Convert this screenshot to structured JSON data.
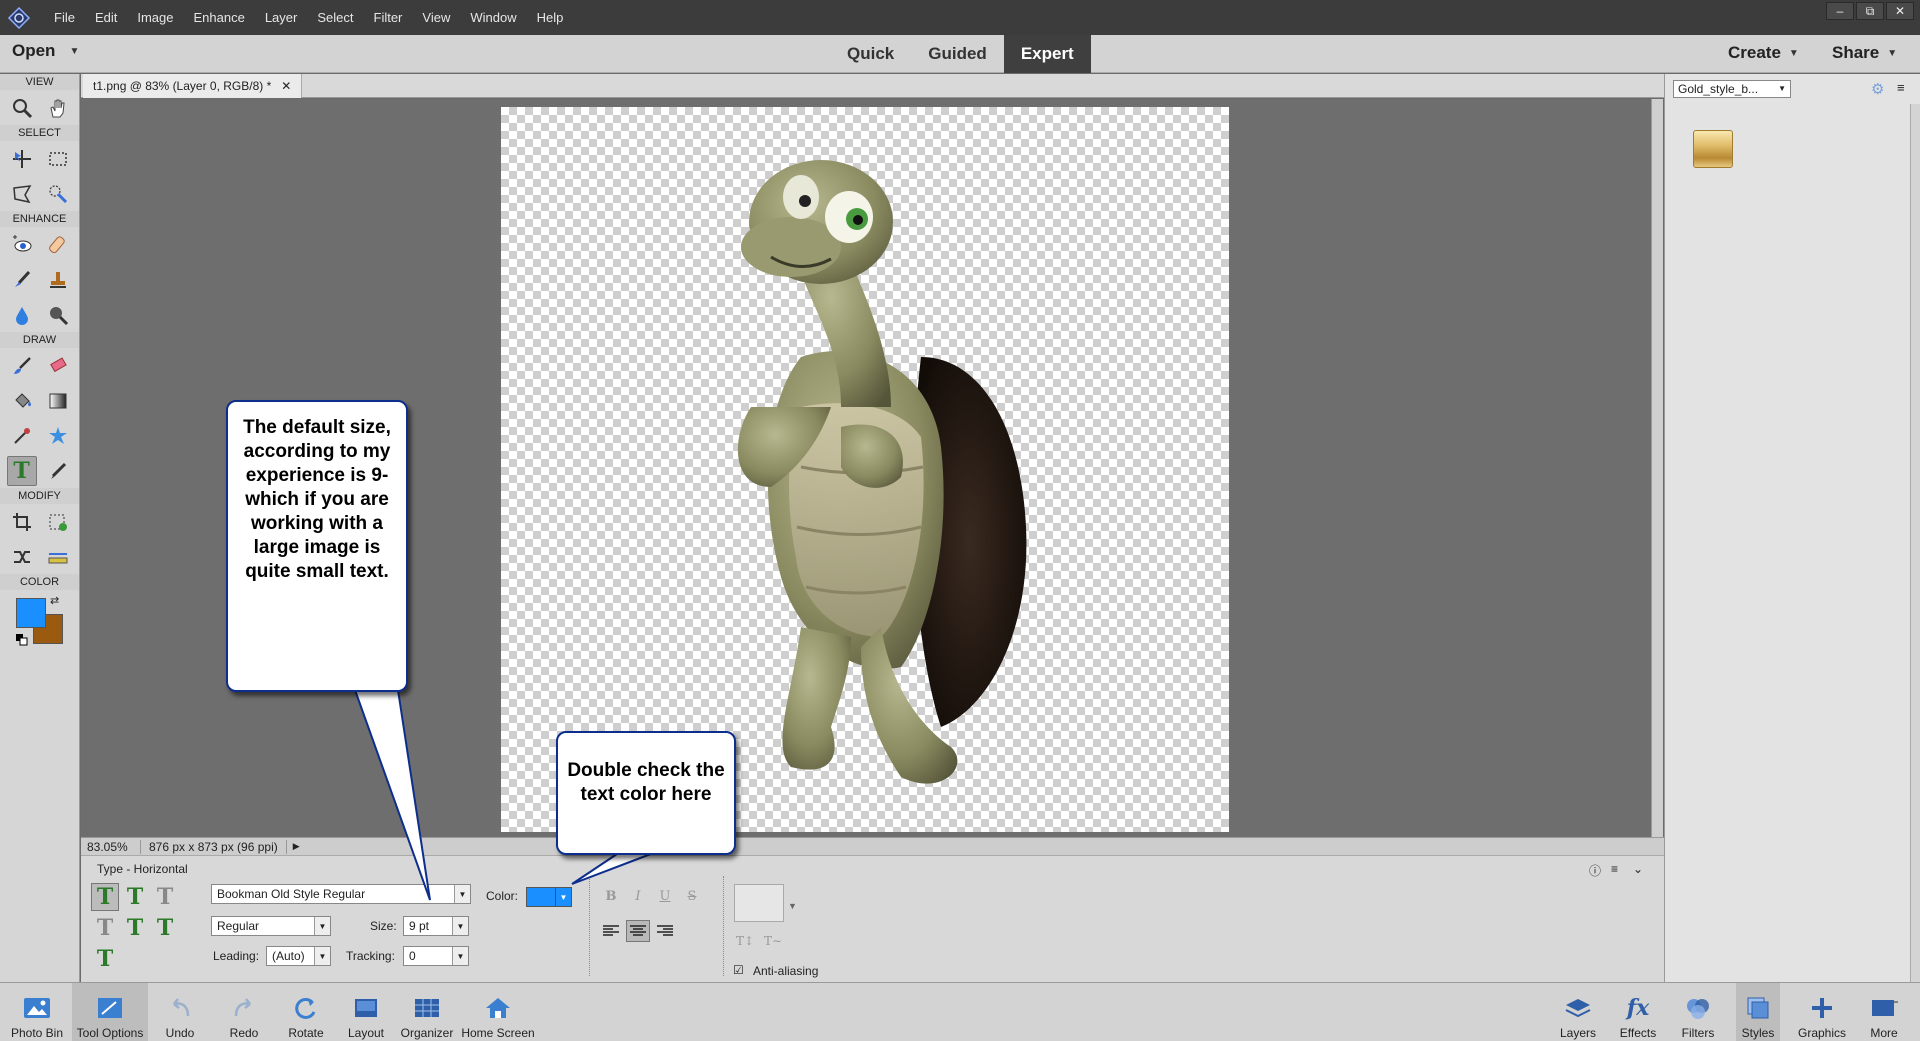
{
  "menubar": {
    "items": [
      "File",
      "Edit",
      "Image",
      "Enhance",
      "Layer",
      "Select",
      "Filter",
      "View",
      "Window",
      "Help"
    ]
  },
  "topbar": {
    "open_label": "Open",
    "modes": [
      "Quick",
      "Guided",
      "Expert"
    ],
    "active_mode": "Expert",
    "create_label": "Create",
    "share_label": "Share"
  },
  "toolbox": {
    "sections": {
      "view": "VIEW",
      "select": "SELECT",
      "enhance": "ENHANCE",
      "draw": "DRAW",
      "modify": "MODIFY",
      "color": "COLOR"
    },
    "foreground_color": "#1a8fff",
    "background_color": "#9a5a10"
  },
  "document": {
    "tab_title": "t1.png @ 83% (Layer 0, RGB/8) *",
    "zoom": "83.05%",
    "dimensions": "876 px x 873 px (96 ppi)"
  },
  "tool_options": {
    "title": "Type - Horizontal",
    "font_family": "Bookman Old Style Regular",
    "font_style": "Regular",
    "size_label": "Size:",
    "size_value": "9 pt",
    "leading_label": "Leading:",
    "leading_value": "(Auto)",
    "tracking_label": "Tracking:",
    "tracking_value": "0",
    "color_label": "Color:",
    "text_color": "#1a8fff",
    "format_buttons": [
      "B",
      "I",
      "U",
      "S"
    ],
    "anti_aliasing_label": "Anti-aliasing",
    "anti_aliasing": true
  },
  "right_panel": {
    "style_selected": "Gold_style_b..."
  },
  "bottombar": {
    "left": [
      "Photo Bin",
      "Tool Options",
      "Undo",
      "Redo",
      "Rotate",
      "Layout",
      "Organizer",
      "Home Screen"
    ],
    "right": [
      "Layers",
      "Effects",
      "Filters",
      "Styles",
      "Graphics",
      "More"
    ]
  },
  "annotations": {
    "callout_size": "The default size, according to my experience is 9- which if you are working with a large image is quite small text.",
    "callout_color": "Double check the text color here"
  }
}
